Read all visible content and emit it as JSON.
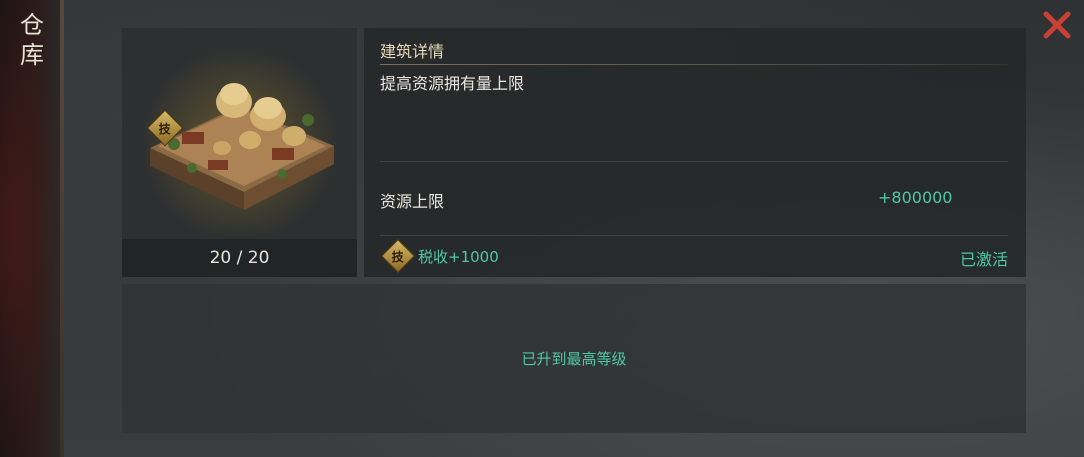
{
  "window": {
    "title": "仓库"
  },
  "building": {
    "tech_badge": "技",
    "level_text": "20 / 20"
  },
  "detail": {
    "title": "建筑详情",
    "description": "提高资源拥有量上限",
    "stat_label": "资源上限",
    "stat_value": "+800000",
    "tech_badge": "技",
    "tech_text": "税收+1000",
    "tech_status": "已激活"
  },
  "upgrade": {
    "status_text": "已升到最高等级"
  },
  "colors": {
    "accent_green": "#4ec9a0",
    "title_gold": "#e7d9b9",
    "close_red": "#c94035"
  },
  "icons": {
    "close": "close-icon",
    "building": "warehouse-building-icon",
    "tech": "tech-badge-icon"
  }
}
